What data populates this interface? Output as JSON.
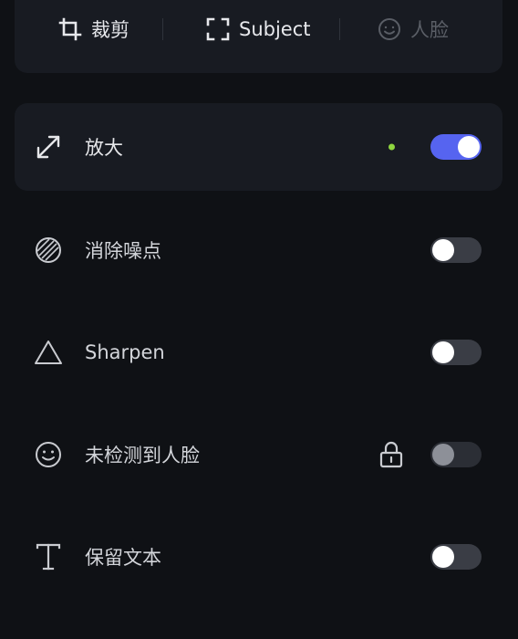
{
  "modes": {
    "crop_label": "裁剪",
    "subject_label": "Subject",
    "face_label": "人脸"
  },
  "options": [
    {
      "id": "upscale",
      "label": "放大",
      "icon": "expand-arrows-icon",
      "enabled": true,
      "active": true,
      "status_dot_color": "#8fd63f"
    },
    {
      "id": "denoise",
      "label": "消除噪点",
      "icon": "noise-reduction-icon",
      "enabled": false
    },
    {
      "id": "sharpen",
      "label": "Sharpen",
      "icon": "triangle-icon",
      "enabled": false
    },
    {
      "id": "face",
      "label": "未检测到人脸",
      "icon": "smiley-face-icon",
      "enabled": false,
      "locked": true
    },
    {
      "id": "text",
      "label": "保留文本",
      "icon": "text-icon",
      "enabled": false
    }
  ],
  "colors": {
    "background": "#0f1115",
    "card": "#181b22",
    "toggle_on": "#5664f0",
    "toggle_off": "#3a3d45",
    "status_dot": "#8fd63f"
  }
}
